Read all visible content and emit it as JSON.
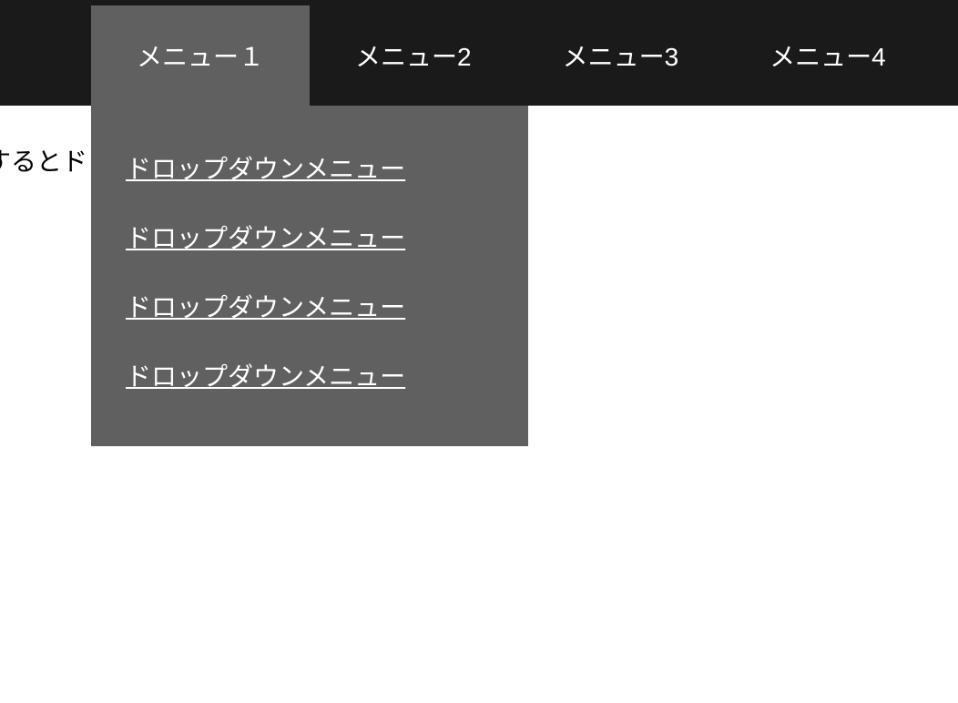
{
  "nav": {
    "items": [
      {
        "label": "メニュー１",
        "active": true
      },
      {
        "label": "メニュー2",
        "active": false
      },
      {
        "label": "メニュー3",
        "active": false
      },
      {
        "label": "メニュー4",
        "active": false
      }
    ]
  },
  "dropdown": {
    "items": [
      {
        "label": "ドロップダウンメニュー"
      },
      {
        "label": "ドロップダウンメニュー"
      },
      {
        "label": "ドロップダウンメニュー"
      },
      {
        "label": "ドロップダウンメニュー"
      }
    ]
  },
  "content": {
    "text": "ューをhoverするとドロップダウンメニューが表示されます。"
  }
}
